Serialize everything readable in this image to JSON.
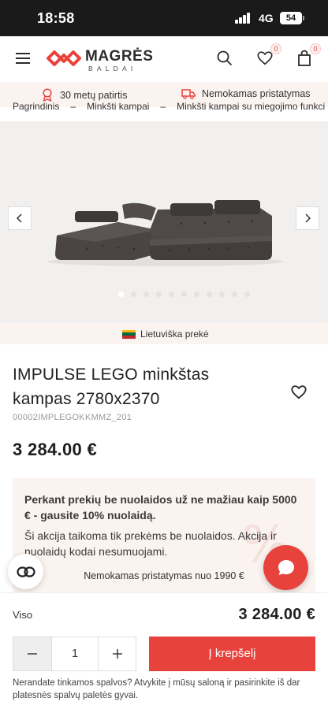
{
  "status_bar": {
    "time": "18:58",
    "network": "4G",
    "battery": "54"
  },
  "header": {
    "logo": {
      "brand": "MAGRĖS",
      "sub": "BALDAI"
    },
    "wishlist_count": "0",
    "cart_count": "0",
    "icons": [
      "menu-icon",
      "search-icon",
      "heart-icon",
      "bag-icon"
    ]
  },
  "promo_bar": {
    "experience": "30 metų patirtis",
    "delivery": "Nemokamas pristatymas"
  },
  "breadcrumb": [
    "Pagrindinis",
    "–",
    "Minkšti kampai",
    "–",
    "Minkšti kampai su miegojimo funkci"
  ],
  "origin_label": "Lietuviška prekė",
  "product": {
    "title": "IMPULSE LEGO minkštas kampas 2780x2370",
    "sku": "00002IMPLEGOKKMMZ_201",
    "price": "3 284.00 €"
  },
  "promo_card": {
    "strong_text": "Perkant prekių be nuolaidos už ne mažiau kaip 5000 € - gausite 10% nuolaidą.",
    "plain_text": "Ši akcija taikoma tik prekėms be nuolaidos. Akcija ir nuolaidų kodai nesumuojami.",
    "decoration": "%",
    "shipping_note": "Nemokamas pristatymas nuo 1990 €"
  },
  "purchase_bar": {
    "total_label": "Viso",
    "total_value": "3 284.00 €",
    "quantity": "1",
    "add_to_cart": "Į krepšelį"
  },
  "bottom_text": "Nerandate tinkamos spalvos? Atvykite į mūsų saloną ir pasirinkite iš dar platesnės spalvų paletės gyvai.",
  "colors": {
    "accent": "#e8423c",
    "promo_bg": "#fbf3f0",
    "gallery_bg": "#f2f0ef"
  }
}
